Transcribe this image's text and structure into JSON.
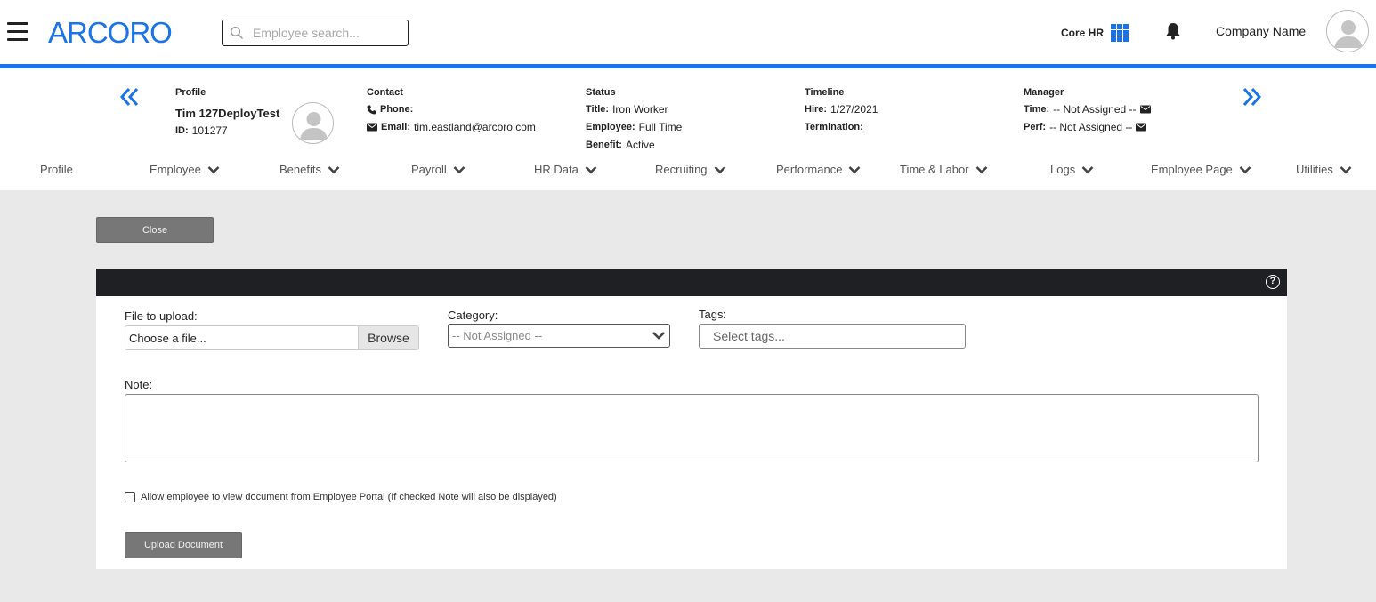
{
  "topbar": {
    "logo": "ARCORO",
    "search_placeholder": "Employee search...",
    "module_label": "Core HR",
    "company_name": "Company Name",
    "icons": [
      "menu-icon",
      "search-icon",
      "apps-grid-icon",
      "bell-icon",
      "user-avatar-icon"
    ]
  },
  "employee": {
    "profile_heading": "Profile",
    "name": "Tim 127DeployTest",
    "id_label": "ID:",
    "id_value": "101277",
    "contact": {
      "heading": "Contact",
      "phone_label": "Phone:",
      "phone_value": "",
      "email_label": "Email:",
      "email_value": "tim.eastland@arcoro.com"
    },
    "status": {
      "heading": "Status",
      "title_label": "Title:",
      "title_value": "Iron Worker",
      "employee_label": "Employee:",
      "employee_value": "Full Time",
      "benefit_label": "Benefit:",
      "benefit_value": "Active"
    },
    "timeline": {
      "heading": "Timeline",
      "hire_label": "Hire:",
      "hire_value": "1/27/2021",
      "termination_label": "Termination:",
      "termination_value": ""
    },
    "manager": {
      "heading": "Manager",
      "time_label": "Time:",
      "time_value": "-- Not Assigned --",
      "perf_label": "Perf:",
      "perf_value": "-- Not Assigned --"
    }
  },
  "nav": {
    "tabs": [
      {
        "label": "Profile",
        "dropdown": false
      },
      {
        "label": "Employee",
        "dropdown": true
      },
      {
        "label": "Benefits",
        "dropdown": true
      },
      {
        "label": "Payroll",
        "dropdown": true
      },
      {
        "label": "HR Data",
        "dropdown": true
      },
      {
        "label": "Recruiting",
        "dropdown": true
      },
      {
        "label": "Performance",
        "dropdown": true
      },
      {
        "label": "Time & Labor",
        "dropdown": true
      },
      {
        "label": "Logs",
        "dropdown": true
      },
      {
        "label": "Employee Page",
        "dropdown": true
      },
      {
        "label": "Utilities",
        "dropdown": true
      }
    ]
  },
  "form": {
    "close_label": "Close",
    "file_label": "File to upload:",
    "file_placeholder": "Choose a file...",
    "browse_label": "Browse",
    "category_label": "Category:",
    "category_value": "-- Not Assigned --",
    "tags_label": "Tags:",
    "tags_placeholder": "Select tags...",
    "note_label": "Note:",
    "note_value": "",
    "portal_checkbox_label": "Allow employee to view document from Employee Portal (If checked Note will also be displayed)",
    "portal_checked": false,
    "upload_label": "Upload Document"
  },
  "colors": {
    "accent": "#1a73e8",
    "panel_bar": "#1f2023",
    "button_gray": "#777777",
    "page_bg": "#e9e9e9"
  }
}
